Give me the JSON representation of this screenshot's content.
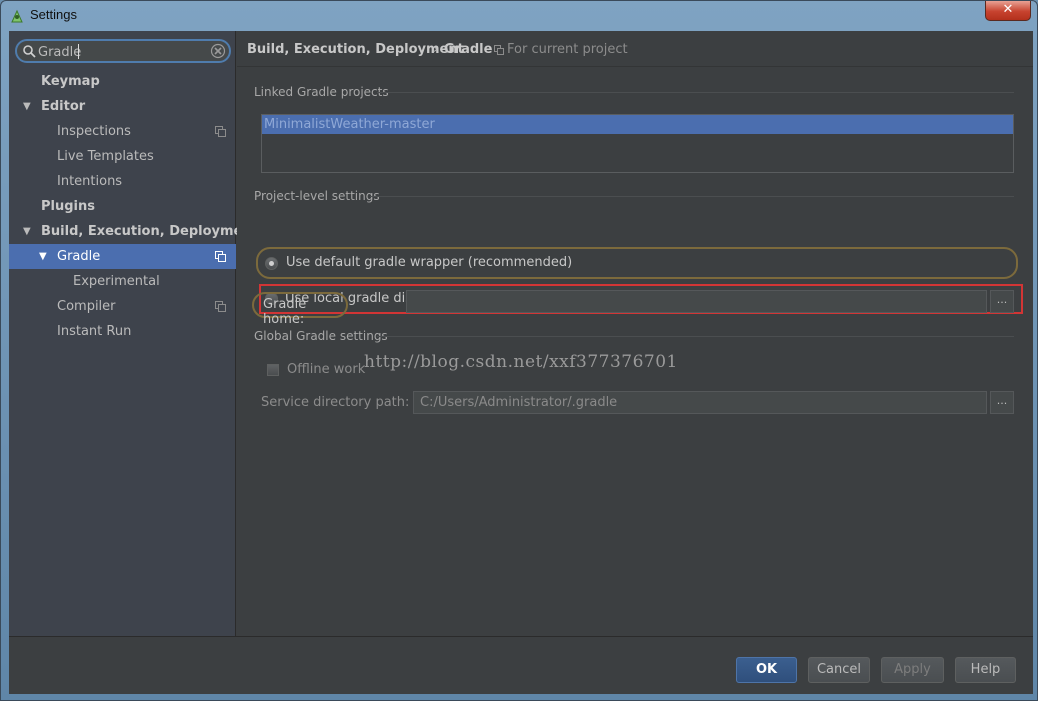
{
  "window": {
    "title": "Settings",
    "close_glyph": "✕"
  },
  "sidebar": {
    "search": {
      "value": "Gradle",
      "placeholder": ""
    },
    "items": [
      {
        "label": "Keymap"
      },
      {
        "label": "Editor"
      },
      {
        "label": "Inspections"
      },
      {
        "label": "Live Templates"
      },
      {
        "label": "Intentions"
      },
      {
        "label": "Plugins"
      },
      {
        "label": "Build, Execution, Deployment"
      },
      {
        "label": "Gradle"
      },
      {
        "label": "Experimental"
      },
      {
        "label": "Compiler"
      },
      {
        "label": "Instant Run"
      }
    ],
    "arrow_glyph": "▼"
  },
  "breadcrumb": {
    "parent": "Build, Execution, Deployment",
    "separator": "›",
    "current": "Gradle",
    "scope": "For current project"
  },
  "content": {
    "linked_title": "Linked Gradle projects",
    "linked_projects": [
      "MinimalistWeather-master"
    ],
    "project_level_title": "Project-level settings",
    "radio_default": "Use default gradle wrapper (recommended)",
    "radio_local": "Use local gradle distribution",
    "gradle_home_label": "Gradle home:",
    "gradle_home_value": "",
    "browse_label": "...",
    "global_title": "Global Gradle settings",
    "offline_label": "Offline work",
    "service_label": "Service directory path:",
    "service_value": "C:/Users/Administrator/.gradle",
    "watermark": "http://blog.csdn.net/xxf377376701"
  },
  "footer": {
    "ok": "OK",
    "cancel": "Cancel",
    "apply": "Apply",
    "help": "Help"
  },
  "colors": {
    "selection": "#4b6eaf",
    "panel": "#3c3f41",
    "highlight_red": "#d23535",
    "highlight_orange": "#7c6a3c"
  }
}
